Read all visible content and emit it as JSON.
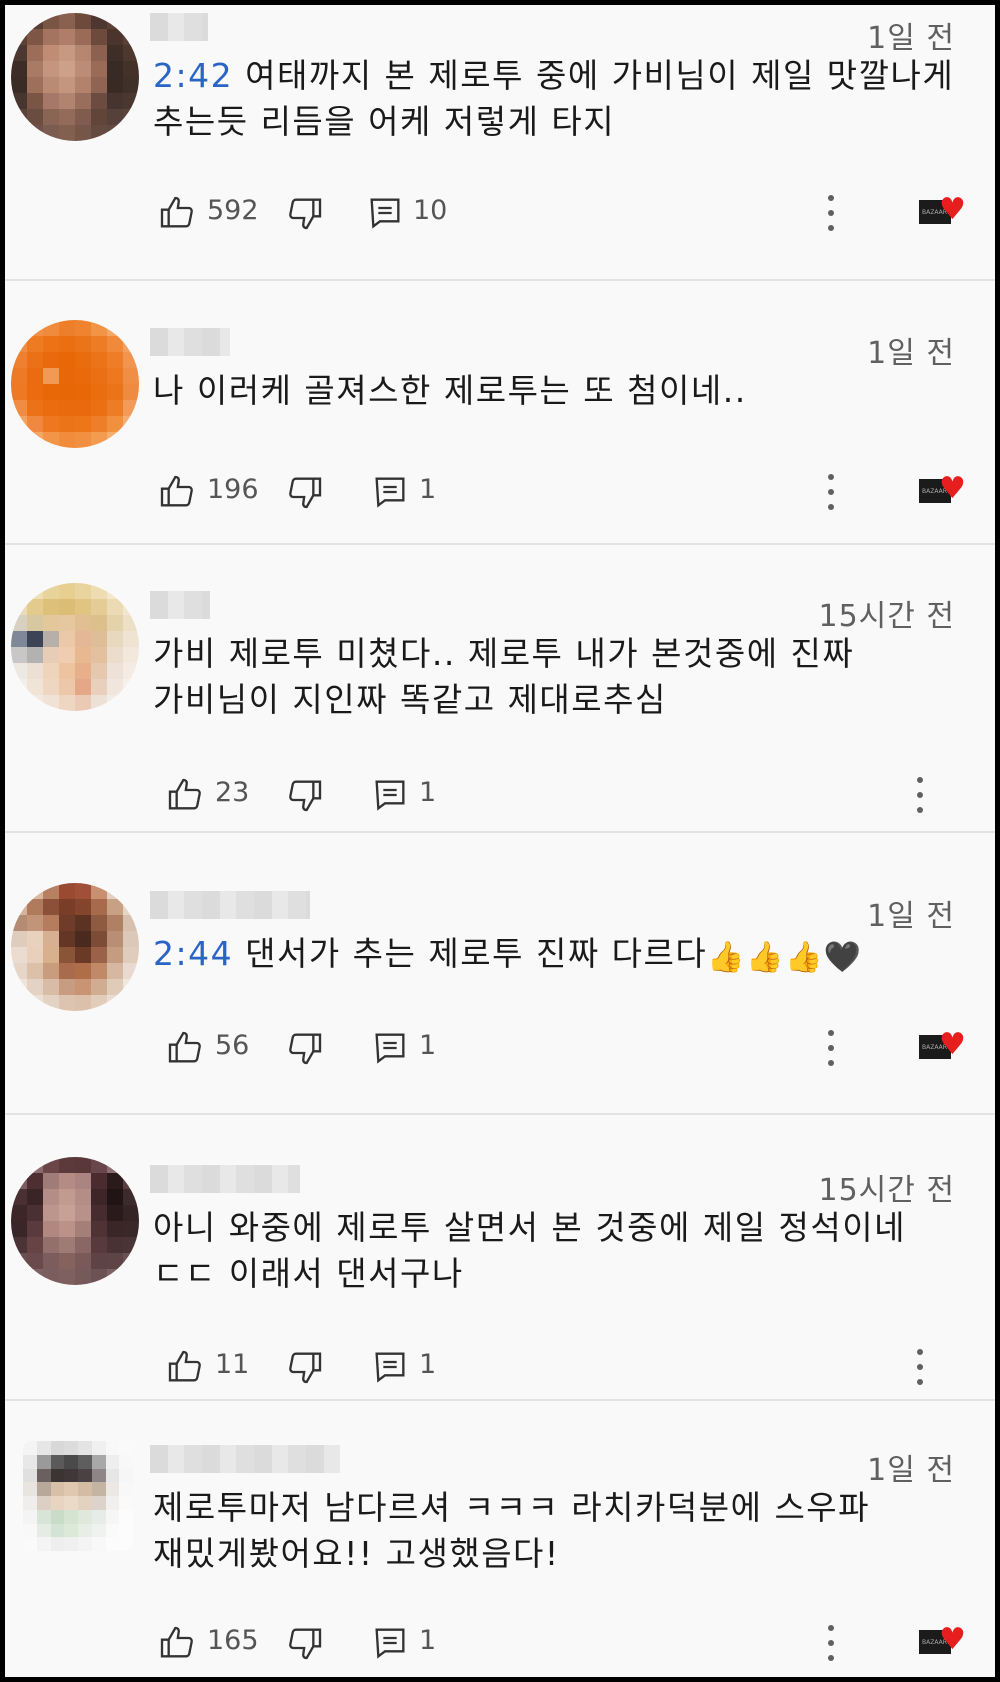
{
  "comments": [
    {
      "time": "1일 전",
      "timestamp_link": "2:42",
      "text": "여태까지 본 제로투 중에 가비님이 제일 맛깔나게 추는듯 리듬을 어케 저렇게 타지",
      "likes": "592",
      "replies": "10",
      "creator_heart": true
    },
    {
      "time": "1일 전",
      "timestamp_link": "",
      "text": "나 이러케 골져스한 제로투는 또 첨이네..",
      "likes": "196",
      "replies": "1",
      "creator_heart": true
    },
    {
      "time": "15시간 전",
      "timestamp_link": "",
      "text": "가비 제로투 미쳤다.. 제로투 내가 본것중에 진짜 가비님이 지인짜 똑같고 제대로추심",
      "likes": "23",
      "replies": "1",
      "creator_heart": false
    },
    {
      "time": "1일 전",
      "timestamp_link": "2:44",
      "text": "댄서가 추는 제로투 진짜 다르다",
      "emojis": "👍👍👍🖤",
      "likes": "56",
      "replies": "1",
      "creator_heart": true
    },
    {
      "time": "15시간 전",
      "timestamp_link": "",
      "text": "아니 와중에 제로투 살면서 본 것중에 제일 정석이네 ㄷㄷ 이래서 댄서구나",
      "likes": "11",
      "replies": "1",
      "creator_heart": false
    },
    {
      "time": "1일 전",
      "timestamp_link": "",
      "text": "제로투마저 남다르셔 ㅋㅋㅋ 라치카덕분에 스우파 재밌게봤어요!! 고생했음다!",
      "likes": "165",
      "replies": "1",
      "creator_heart": true
    }
  ],
  "colors": {
    "background": "#f9f9f9",
    "timestamp_link": "#2a65c6",
    "heart": "#e61e1e",
    "text": "#1a1a1a",
    "meta": "#606060"
  },
  "icons": {
    "like": "thumb-up-icon",
    "dislike": "thumb-down-icon",
    "reply": "reply-comment-icon",
    "more": "vertical-ellipsis-icon",
    "heart": "creator-heart-icon"
  }
}
